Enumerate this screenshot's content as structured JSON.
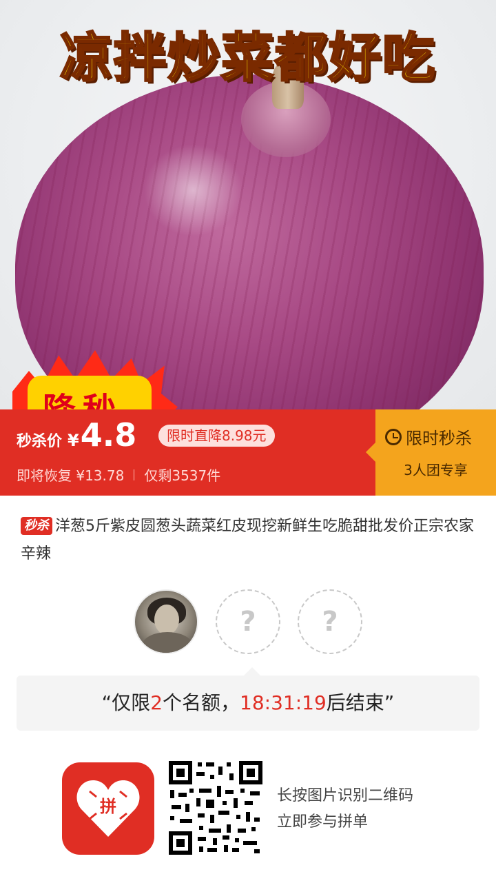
{
  "product_image": {
    "headline": "凉拌炒菜都好吃",
    "burst_text": "降秒"
  },
  "price_banner": {
    "label": "秒杀价",
    "currency": "¥",
    "price": "4.8",
    "drop_badge": "限时直降8.98元",
    "restore_text": "即将恢复 ¥13.78",
    "stock_text": "仅剩3537件",
    "flash_sale": "限时秒杀",
    "group_only": "3人团专享",
    "colors": {
      "red": "#e02e24",
      "orange": "#f4a41d"
    }
  },
  "product": {
    "tag": "秒杀",
    "title": "洋葱5斤紫皮圆葱头蔬菜红皮现挖新鲜生吃脆甜批发价正宗农家辛辣"
  },
  "group": {
    "members": [
      {
        "status": "joined",
        "icon": "user-avatar"
      },
      {
        "status": "empty",
        "icon": "question-mark-icon",
        "symbol": "?"
      },
      {
        "status": "empty",
        "icon": "question-mark-icon",
        "symbol": "?"
      }
    ],
    "quote_open": "“仅限",
    "slots": "2",
    "quote_mid": "个名额，",
    "countdown": "18:31:19",
    "quote_close": "后结束”"
  },
  "footer": {
    "logo_text": "拼",
    "scan_line1": "长按图片识别二维码",
    "scan_line2": "立即参与拼单"
  }
}
